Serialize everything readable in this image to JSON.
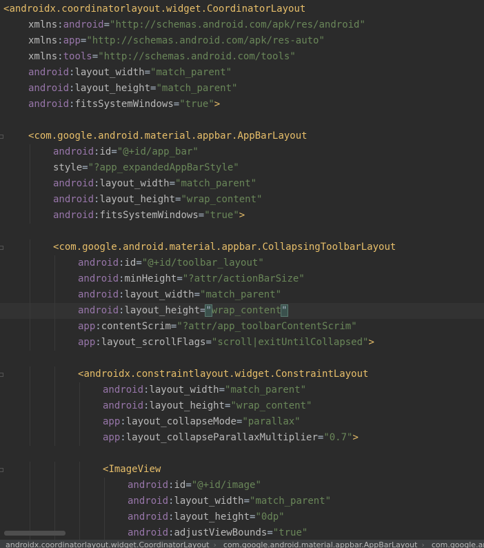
{
  "editor": {
    "code_lines": [
      {
        "n": 0,
        "tokens": [
          [
            "tk-brk",
            "<"
          ],
          [
            "tk-tag",
            "androidx.coordinatorlayout.widget.CoordinatorLayout"
          ]
        ]
      },
      {
        "n": 1,
        "tokens": [
          [
            "tk-attr",
            "xmlns"
          ],
          [
            "tk-plain",
            ":"
          ],
          [
            "tk-ns",
            "android"
          ],
          [
            "tk-plain",
            "="
          ],
          [
            "tk-str",
            "\"http://schemas.android.com/apk/res/android\""
          ]
        ]
      },
      {
        "n": 1,
        "tokens": [
          [
            "tk-attr",
            "xmlns"
          ],
          [
            "tk-plain",
            ":"
          ],
          [
            "tk-ns",
            "app"
          ],
          [
            "tk-plain",
            "="
          ],
          [
            "tk-str",
            "\"http://schemas.android.com/apk/res-auto\""
          ]
        ]
      },
      {
        "n": 1,
        "tokens": [
          [
            "tk-attr",
            "xmlns"
          ],
          [
            "tk-plain",
            ":"
          ],
          [
            "tk-ns",
            "tools"
          ],
          [
            "tk-plain",
            "="
          ],
          [
            "tk-str",
            "\"http://schemas.android.com/tools\""
          ]
        ]
      },
      {
        "n": 1,
        "tokens": [
          [
            "tk-ns",
            "android"
          ],
          [
            "tk-plain",
            ":"
          ],
          [
            "tk-attr",
            "layout_width"
          ],
          [
            "tk-plain",
            "="
          ],
          [
            "tk-str",
            "\"match_parent\""
          ]
        ]
      },
      {
        "n": 1,
        "tokens": [
          [
            "tk-ns",
            "android"
          ],
          [
            "tk-plain",
            ":"
          ],
          [
            "tk-attr",
            "layout_height"
          ],
          [
            "tk-plain",
            "="
          ],
          [
            "tk-str",
            "\"match_parent\""
          ]
        ]
      },
      {
        "n": 1,
        "tokens": [
          [
            "tk-ns",
            "android"
          ],
          [
            "tk-plain",
            ":"
          ],
          [
            "tk-attr",
            "fitsSystemWindows"
          ],
          [
            "tk-plain",
            "="
          ],
          [
            "tk-str",
            "\"true\""
          ],
          [
            "tk-brk",
            ">"
          ]
        ]
      },
      {
        "n": 0,
        "tokens": []
      },
      {
        "n": 1,
        "fold": true,
        "tokens": [
          [
            "tk-brk",
            "<"
          ],
          [
            "tk-tag",
            "com.google.android.material.appbar.AppBarLayout"
          ]
        ]
      },
      {
        "n": 2,
        "tokens": [
          [
            "tk-ns",
            "android"
          ],
          [
            "tk-plain",
            ":"
          ],
          [
            "tk-attr",
            "id"
          ],
          [
            "tk-plain",
            "="
          ],
          [
            "tk-str",
            "\"@+id/app_bar\""
          ]
        ]
      },
      {
        "n": 2,
        "tokens": [
          [
            "tk-attr",
            "style"
          ],
          [
            "tk-plain",
            "="
          ],
          [
            "tk-str",
            "\"?app_expandedAppBarStyle\""
          ]
        ]
      },
      {
        "n": 2,
        "tokens": [
          [
            "tk-ns",
            "android"
          ],
          [
            "tk-plain",
            ":"
          ],
          [
            "tk-attr",
            "layout_width"
          ],
          [
            "tk-plain",
            "="
          ],
          [
            "tk-str",
            "\"match_parent\""
          ]
        ]
      },
      {
        "n": 2,
        "tokens": [
          [
            "tk-ns",
            "android"
          ],
          [
            "tk-plain",
            ":"
          ],
          [
            "tk-attr",
            "layout_height"
          ],
          [
            "tk-plain",
            "="
          ],
          [
            "tk-str",
            "\"wrap_content\""
          ]
        ]
      },
      {
        "n": 2,
        "tokens": [
          [
            "tk-ns",
            "android"
          ],
          [
            "tk-plain",
            ":"
          ],
          [
            "tk-attr",
            "fitsSystemWindows"
          ],
          [
            "tk-plain",
            "="
          ],
          [
            "tk-str",
            "\"true\""
          ],
          [
            "tk-brk",
            ">"
          ]
        ]
      },
      {
        "n": 0,
        "tokens": []
      },
      {
        "n": 2,
        "fold": true,
        "tokens": [
          [
            "tk-brk",
            "<"
          ],
          [
            "tk-tag",
            "com.google.android.material.appbar.CollapsingToolbarLayout"
          ]
        ]
      },
      {
        "n": 3,
        "tokens": [
          [
            "tk-ns",
            "android"
          ],
          [
            "tk-plain",
            ":"
          ],
          [
            "tk-attr",
            "id"
          ],
          [
            "tk-plain",
            "="
          ],
          [
            "tk-str",
            "\"@+id/toolbar_layout\""
          ]
        ]
      },
      {
        "n": 3,
        "tokens": [
          [
            "tk-ns",
            "android"
          ],
          [
            "tk-plain",
            ":"
          ],
          [
            "tk-attr",
            "minHeight"
          ],
          [
            "tk-plain",
            "="
          ],
          [
            "tk-str",
            "\"?attr/actionBarSize\""
          ]
        ]
      },
      {
        "n": 3,
        "tokens": [
          [
            "tk-ns",
            "android"
          ],
          [
            "tk-plain",
            ":"
          ],
          [
            "tk-attr",
            "layout_width"
          ],
          [
            "tk-plain",
            "="
          ],
          [
            "tk-str",
            "\"match_parent\""
          ]
        ]
      },
      {
        "n": 3,
        "highlight": true,
        "tokens": [
          [
            "tk-ns",
            "android"
          ],
          [
            "tk-plain",
            ":"
          ],
          [
            "tk-attr",
            "layout_height"
          ],
          [
            "tk-plain",
            "="
          ],
          [
            "tk-match",
            "\""
          ],
          [
            "tk-str",
            "wrap_content"
          ],
          [
            "tk-match",
            "\""
          ]
        ]
      },
      {
        "n": 3,
        "tokens": [
          [
            "tk-ns",
            "app"
          ],
          [
            "tk-plain",
            ":"
          ],
          [
            "tk-attr",
            "contentScrim"
          ],
          [
            "tk-plain",
            "="
          ],
          [
            "tk-str",
            "\"?attr/app_toolbarContentScrim\""
          ]
        ]
      },
      {
        "n": 3,
        "tokens": [
          [
            "tk-ns",
            "app"
          ],
          [
            "tk-plain",
            ":"
          ],
          [
            "tk-attr",
            "layout_scrollFlags"
          ],
          [
            "tk-plain",
            "="
          ],
          [
            "tk-str",
            "\"scroll|exitUntilCollapsed\""
          ],
          [
            "tk-brk",
            ">"
          ]
        ]
      },
      {
        "n": 0,
        "tokens": []
      },
      {
        "n": 3,
        "fold": true,
        "tokens": [
          [
            "tk-brk",
            "<"
          ],
          [
            "tk-tag",
            "androidx.constraintlayout.widget.ConstraintLayout"
          ]
        ]
      },
      {
        "n": 4,
        "tokens": [
          [
            "tk-ns",
            "android"
          ],
          [
            "tk-plain",
            ":"
          ],
          [
            "tk-attr",
            "layout_width"
          ],
          [
            "tk-plain",
            "="
          ],
          [
            "tk-str",
            "\"match_parent\""
          ]
        ]
      },
      {
        "n": 4,
        "tokens": [
          [
            "tk-ns",
            "android"
          ],
          [
            "tk-plain",
            ":"
          ],
          [
            "tk-attr",
            "layout_height"
          ],
          [
            "tk-plain",
            "="
          ],
          [
            "tk-str",
            "\"wrap_content\""
          ]
        ]
      },
      {
        "n": 4,
        "tokens": [
          [
            "tk-ns",
            "app"
          ],
          [
            "tk-plain",
            ":"
          ],
          [
            "tk-attr",
            "layout_collapseMode"
          ],
          [
            "tk-plain",
            "="
          ],
          [
            "tk-str",
            "\"parallax\""
          ]
        ]
      },
      {
        "n": 4,
        "tokens": [
          [
            "tk-ns",
            "app"
          ],
          [
            "tk-plain",
            ":"
          ],
          [
            "tk-attr",
            "layout_collapseParallaxMultiplier"
          ],
          [
            "tk-plain",
            "="
          ],
          [
            "tk-str",
            "\"0.7\""
          ],
          [
            "tk-brk",
            ">"
          ]
        ]
      },
      {
        "n": 0,
        "tokens": []
      },
      {
        "n": 4,
        "fold": true,
        "tokens": [
          [
            "tk-brk",
            "<"
          ],
          [
            "tk-tag",
            "ImageView"
          ]
        ]
      },
      {
        "n": 5,
        "tokens": [
          [
            "tk-ns",
            "android"
          ],
          [
            "tk-plain",
            ":"
          ],
          [
            "tk-attr",
            "id"
          ],
          [
            "tk-plain",
            "="
          ],
          [
            "tk-str",
            "\"@+id/image\""
          ]
        ]
      },
      {
        "n": 5,
        "tokens": [
          [
            "tk-ns",
            "android"
          ],
          [
            "tk-plain",
            ":"
          ],
          [
            "tk-attr",
            "layout_width"
          ],
          [
            "tk-plain",
            "="
          ],
          [
            "tk-str",
            "\"match_parent\""
          ]
        ]
      },
      {
        "n": 5,
        "tokens": [
          [
            "tk-ns",
            "android"
          ],
          [
            "tk-plain",
            ":"
          ],
          [
            "tk-attr",
            "layout_height"
          ],
          [
            "tk-plain",
            "="
          ],
          [
            "tk-str",
            "\"0dp\""
          ]
        ]
      },
      {
        "n": 5,
        "tokens": [
          [
            "tk-ns",
            "android"
          ],
          [
            "tk-plain",
            ":"
          ],
          [
            "tk-attr",
            "adjustViewBounds"
          ],
          [
            "tk-plain",
            "="
          ],
          [
            "tk-str",
            "\"true\""
          ]
        ]
      }
    ]
  },
  "breadcrumbs": [
    "androidx.coordinatorlayout.widget.CoordinatorLayout",
    "com.google.android.material.appbar.AppBarLayout",
    "com.google.andr"
  ]
}
